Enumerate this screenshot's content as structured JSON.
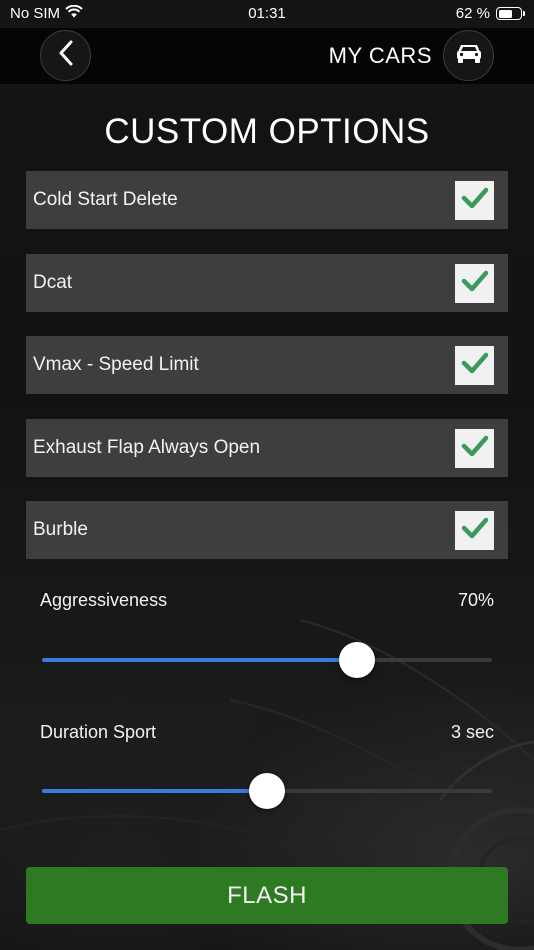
{
  "status_bar": {
    "carrier": "No SIM",
    "time": "01:31",
    "battery_percent": "62 %",
    "battery_level": 0.62
  },
  "header": {
    "back_icon": "chevron-left-icon",
    "my_cars_label": "MY CARS",
    "car_icon": "car-icon"
  },
  "title": "CUSTOM OPTIONS",
  "options": [
    {
      "label": "Cold Start Delete",
      "checked": true
    },
    {
      "label": "Dcat",
      "checked": true
    },
    {
      "label": "Vmax - Speed Limit",
      "checked": true
    },
    {
      "label": "Exhaust Flap Always Open",
      "checked": true
    },
    {
      "label": "Burble",
      "checked": true
    }
  ],
  "sliders": [
    {
      "label": "Aggressiveness",
      "value": "70%",
      "fraction": 0.7
    },
    {
      "label": "Duration Sport",
      "value": "3 sec",
      "fraction": 0.5
    }
  ],
  "flash_label": "FLASH",
  "colors": {
    "check": "#3a9a5b",
    "slider_fill": "#3a7be0",
    "flash_button": "#2e7a23"
  }
}
